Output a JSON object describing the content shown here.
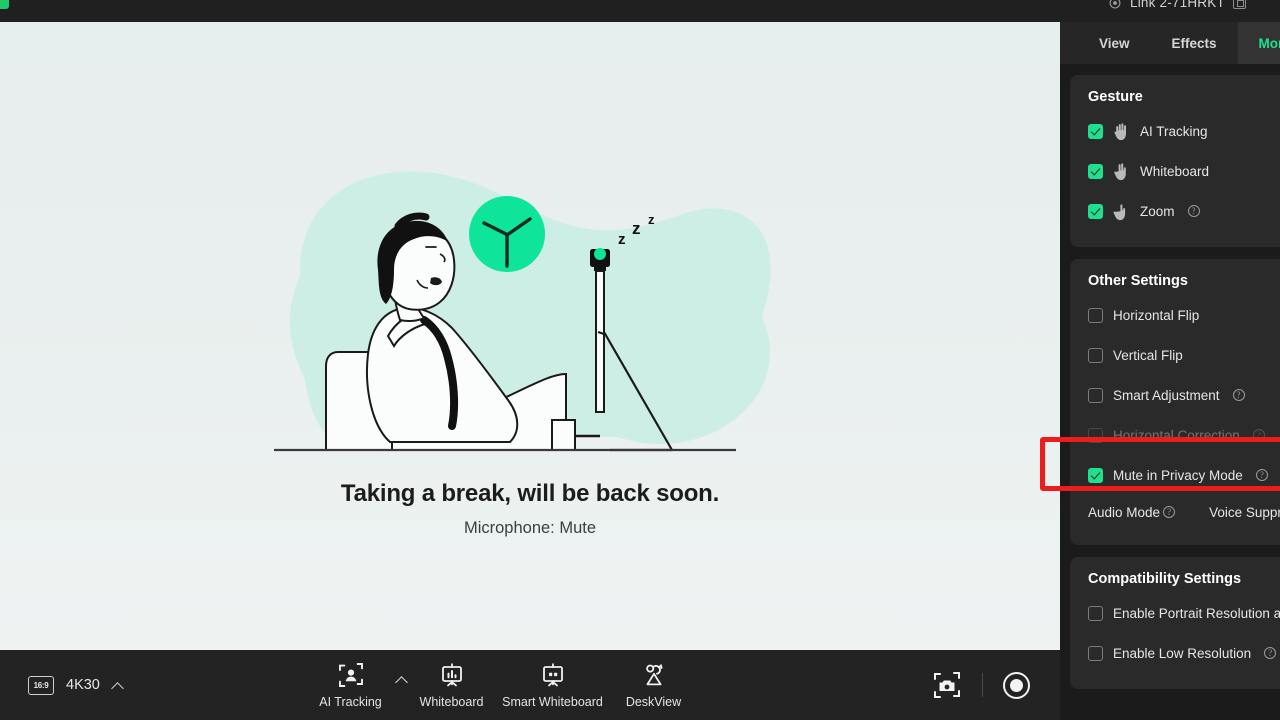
{
  "window": {
    "title": "Link 2-71HRKT",
    "device_icon": "camera-device-icon",
    "window_box_icon": "window-restore-icon"
  },
  "stage": {
    "caption_main": "Taking a break, will be back soon.",
    "caption_sub": "Microphone: Mute",
    "illustration": {
      "name": "person-resting-privacy-mode-illustration",
      "clock_icon": "clock-icon",
      "webcam_icon": "webcam-on-stand-icon",
      "sleep_marks": [
        "z",
        "z",
        "z"
      ]
    },
    "colors": {
      "accent_green": "#0ee49a",
      "blob_mint": "#cdeee5",
      "background": "#e9efee"
    }
  },
  "toolbar": {
    "aspect_ratio_badge": "16:9",
    "resolution": "4K30",
    "resolution_caret_icon": "chevron-up-icon",
    "items": [
      {
        "label": "AI Tracking",
        "icon": "ai-tracking-face-frame-icon"
      },
      {
        "label": "Whiteboard",
        "icon": "whiteboard-icon"
      },
      {
        "label": "Smart Whiteboard",
        "icon": "smart-whiteboard-icon"
      },
      {
        "label": "DeskView",
        "icon": "deskview-icon"
      }
    ],
    "ai_tracking_caret_icon": "chevron-up-icon",
    "snapshot_icon": "snapshot-camera-icon",
    "record_icon": "record-button-icon"
  },
  "panel": {
    "tabs": [
      {
        "label": "View",
        "active": false
      },
      {
        "label": "Effects",
        "active": false
      },
      {
        "label": "More",
        "active": true
      }
    ],
    "accent_green": "#1ee08f",
    "highlight_color": "#ef1c1c",
    "sections": [
      {
        "title": "Gesture",
        "rows": [
          {
            "label": "AI Tracking",
            "checked": true,
            "disabled": false,
            "hand_icon": "hand-open-palm-icon",
            "help": false
          },
          {
            "label": "Whiteboard",
            "checked": true,
            "disabled": false,
            "hand_icon": "hand-two-fingers-icon",
            "help": false
          },
          {
            "label": "Zoom",
            "checked": true,
            "disabled": false,
            "hand_icon": "hand-one-finger-icon",
            "help": true
          }
        ]
      },
      {
        "title": "Other Settings",
        "rows": [
          {
            "label": "Horizontal Flip",
            "checked": false,
            "disabled": false,
            "hand_icon": null,
            "help": false
          },
          {
            "label": "Vertical Flip",
            "checked": false,
            "disabled": false,
            "hand_icon": null,
            "help": false
          },
          {
            "label": "Smart Adjustment",
            "checked": false,
            "disabled": false,
            "hand_icon": null,
            "help": true
          },
          {
            "label": "Horizontal Correction",
            "checked": false,
            "disabled": true,
            "hand_icon": null,
            "help": true
          },
          {
            "label": "Mute in Privacy Mode",
            "checked": true,
            "disabled": false,
            "hand_icon": null,
            "help": true,
            "highlighted": true
          }
        ],
        "audio_row": [
          {
            "label": "Audio Mode",
            "help": true
          },
          {
            "label": "Voice Suppression",
            "help": false
          }
        ]
      },
      {
        "title": "Compatibility Settings",
        "rows": [
          {
            "label": "Enable Portrait Resolution and Frame Rate",
            "checked": false,
            "disabled": false,
            "hand_icon": null,
            "help": false
          },
          {
            "label": "Enable Low Resolution",
            "checked": false,
            "disabled": false,
            "hand_icon": null,
            "help": true
          }
        ]
      }
    ]
  }
}
